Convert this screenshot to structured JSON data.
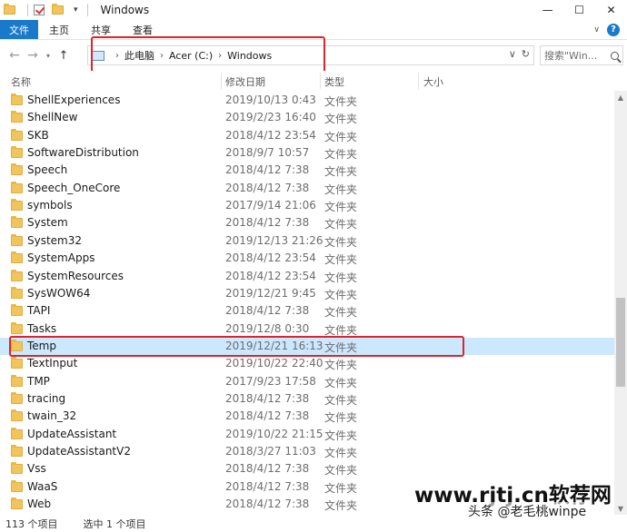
{
  "window": {
    "title": "Windows",
    "controls": {
      "minimize": "—",
      "maximize": "☐",
      "close": "✕"
    }
  },
  "ribbon": {
    "tabs": [
      {
        "label": "文件",
        "active": true
      },
      {
        "label": "主页"
      },
      {
        "label": "共享"
      },
      {
        "label": "查看"
      }
    ],
    "help": "?"
  },
  "nav": {
    "back": "←",
    "forward": "→",
    "up": "↑",
    "recent": "▾",
    "breadcrumb": [
      "此电脑",
      "Acer (C:)",
      "Windows"
    ],
    "search_placeholder": "搜索\"Win...",
    "refresh": "↻",
    "dropdown": "∨"
  },
  "columns": {
    "name": "名称",
    "date": "修改日期",
    "type": "类型",
    "size": "大小"
  },
  "files": [
    {
      "name": "ShellExperiences",
      "date": "2019/10/13 0:43",
      "type": "文件夹"
    },
    {
      "name": "ShellNew",
      "date": "2019/2/23 16:40",
      "type": "文件夹"
    },
    {
      "name": "SKB",
      "date": "2018/4/12 23:54",
      "type": "文件夹"
    },
    {
      "name": "SoftwareDistribution",
      "date": "2018/9/7 10:57",
      "type": "文件夹"
    },
    {
      "name": "Speech",
      "date": "2018/4/12 7:38",
      "type": "文件夹"
    },
    {
      "name": "Speech_OneCore",
      "date": "2018/4/12 7:38",
      "type": "文件夹"
    },
    {
      "name": "symbols",
      "date": "2017/9/14 21:06",
      "type": "文件夹"
    },
    {
      "name": "System",
      "date": "2018/4/12 7:38",
      "type": "文件夹"
    },
    {
      "name": "System32",
      "date": "2019/12/13 21:26",
      "type": "文件夹"
    },
    {
      "name": "SystemApps",
      "date": "2018/4/12 23:54",
      "type": "文件夹"
    },
    {
      "name": "SystemResources",
      "date": "2018/4/12 23:54",
      "type": "文件夹"
    },
    {
      "name": "SysWOW64",
      "date": "2019/12/21 9:45",
      "type": "文件夹"
    },
    {
      "name": "TAPI",
      "date": "2018/4/12 7:38",
      "type": "文件夹"
    },
    {
      "name": "Tasks",
      "date": "2019/12/8 0:30",
      "type": "文件夹"
    },
    {
      "name": "Temp",
      "date": "2019/12/21 16:13",
      "type": "文件夹",
      "selected": true
    },
    {
      "name": "TextInput",
      "date": "2019/10/22 22:40",
      "type": "文件夹"
    },
    {
      "name": "TMP",
      "date": "2017/9/23 17:58",
      "type": "文件夹"
    },
    {
      "name": "tracing",
      "date": "2018/4/12 7:38",
      "type": "文件夹"
    },
    {
      "name": "twain_32",
      "date": "2018/4/12 7:38",
      "type": "文件夹"
    },
    {
      "name": "UpdateAssistant",
      "date": "2019/10/22 21:15",
      "type": "文件夹"
    },
    {
      "name": "UpdateAssistantV2",
      "date": "2018/3/27 11:03",
      "type": "文件夹"
    },
    {
      "name": "Vss",
      "date": "2018/4/12 7:38",
      "type": "文件夹"
    },
    {
      "name": "WaaS",
      "date": "2018/4/12 7:38",
      "type": "文件夹"
    },
    {
      "name": "Web",
      "date": "2018/4/12 7:38",
      "type": "文件夹"
    }
  ],
  "status": {
    "count": "113 个项目",
    "selection": "选中 1 个项目"
  },
  "watermark": {
    "main": "www.rjtj.cn软荐网",
    "sub": "头条 @老毛桃winpe"
  },
  "colors": {
    "selection": "#cce8ff",
    "highlight_box": "#d9262c",
    "file_tab": "#1979ca",
    "folder": "#f2c55c"
  }
}
